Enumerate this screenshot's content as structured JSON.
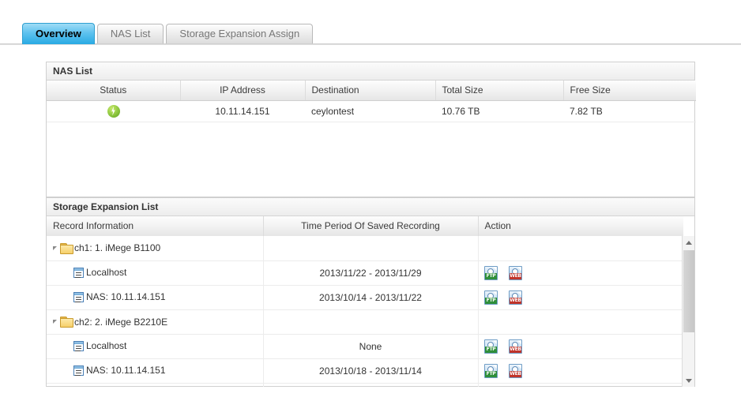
{
  "tabs": [
    {
      "label": "Overview",
      "active": true
    },
    {
      "label": "NAS List",
      "active": false
    },
    {
      "label": "Storage Expansion Assign",
      "active": false
    }
  ],
  "nas_panel": {
    "title": "NAS List",
    "columns": [
      "Status",
      "IP Address",
      "Destination",
      "Total Size",
      "Free Size"
    ],
    "rows": [
      {
        "status_icon": "power-status-icon",
        "ip_address": "10.11.14.151",
        "destination": "ceylontest",
        "total_size": "10.76 TB",
        "free_size": "7.82 TB"
      }
    ]
  },
  "storage_panel": {
    "title": "Storage Expansion List",
    "columns": [
      "Record Information",
      "Time Period Of Saved Recording",
      "Action"
    ],
    "groups": [
      {
        "label": "ch1: 1. iMege B1100",
        "children": [
          {
            "label": "Localhost",
            "time_period": "2013/11/22 - 2013/11/29",
            "actions": [
              "FTP",
              "WEB"
            ]
          },
          {
            "label": "NAS: 10.11.14.151",
            "time_period": "2013/10/14 - 2013/11/22",
            "actions": [
              "FTP",
              "WEB"
            ]
          }
        ]
      },
      {
        "label": "ch2: 2. iMege B2210E",
        "children": [
          {
            "label": "Localhost",
            "time_period": "None",
            "actions": [
              "FTP",
              "WEB"
            ]
          },
          {
            "label": "NAS: 10.11.14.151",
            "time_period": "2013/10/18 - 2013/11/14",
            "actions": [
              "FTP",
              "WEB"
            ]
          }
        ]
      }
    ]
  },
  "colors": {
    "active_tab": "#29aae3",
    "status_green": "#8cc63e",
    "ftp_green": "#2f8f3a",
    "web_red": "#c0342a"
  }
}
